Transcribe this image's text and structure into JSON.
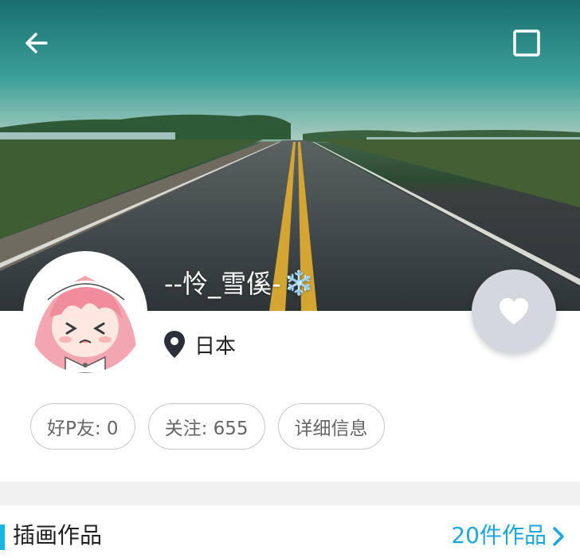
{
  "profile": {
    "username": "--怜_雪傒-",
    "username_emoji": "❄️",
    "location": "日本"
  },
  "stats": {
    "friends_label": "好P友: 0",
    "following_label": "关注: 655",
    "details_label": "详细信息"
  },
  "section": {
    "title": "插画作品",
    "count_label": "20件作品"
  },
  "icons": {
    "back": "back-arrow-icon",
    "window": "square-icon",
    "location": "location-pin-icon",
    "favorite": "heart-icon",
    "chevron": "chevron-right-icon"
  },
  "colors": {
    "accent": "#1ba6dd",
    "favorite_button": "#d4d8de"
  }
}
